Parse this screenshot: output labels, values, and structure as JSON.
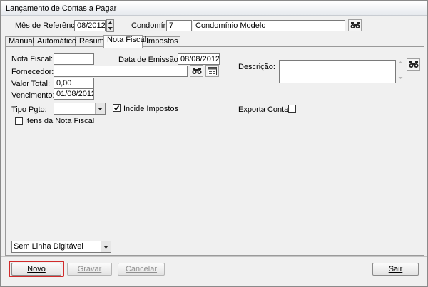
{
  "window": {
    "title": "Lançamento de Contas a Pagar"
  },
  "header": {
    "mes_referencia_label": "Mês de Referência:",
    "mes_referencia_value": "08/2012",
    "condominio_label": "Condomínio:",
    "condominio_code": "7",
    "condominio_name": "Condomínio Modelo"
  },
  "tabs": [
    {
      "label": "Manual",
      "active": false
    },
    {
      "label": "Automático",
      "active": false
    },
    {
      "label": "Resumo",
      "active": false
    },
    {
      "label": "Nota Fiscal",
      "active": true
    },
    {
      "label": "Impostos",
      "active": false
    }
  ],
  "form": {
    "nota_fiscal_label": "Nota Fiscal:",
    "nota_fiscal_value": "",
    "data_emissao_label": "Data de Emissão NF:",
    "data_emissao_value": "08/08/2012",
    "fornecedor_label": "Fornecedor:",
    "fornecedor_value": "",
    "valor_total_label": "Valor Total:",
    "valor_total_value": "0,00",
    "vencimento_label": "Vencimento:",
    "vencimento_value": "01/08/2012",
    "tipo_pgto_label": "Tipo Pgto:",
    "tipo_pgto_value": "",
    "incide_impostos_label": "Incide Impostos",
    "incide_impostos_checked": true,
    "descricao_label": "Descrição:",
    "descricao_value": "",
    "exporta_contabil_label": "Exporta Contabil",
    "exporta_contabil_checked": false,
    "itens_nota_fiscal_label": "Itens da Nota Fiscal",
    "itens_nota_fiscal_checked": false,
    "linha_digitavel_value": "Sem Linha Digitável"
  },
  "footer": {
    "novo_label": "Novo",
    "gravar_label": "Gravar",
    "cancelar_label": "Cancelar",
    "sair_label": "Sair"
  },
  "colors": {
    "highlight": "#d12b2b",
    "panel_bg": "#f0f0f0",
    "disabled_text": "#8f8f8f"
  },
  "icons": [
    "binoculars-icon",
    "spin-up-icon",
    "spin-down-icon",
    "register-icon",
    "dropdown-arrow-icon",
    "check-icon"
  ]
}
